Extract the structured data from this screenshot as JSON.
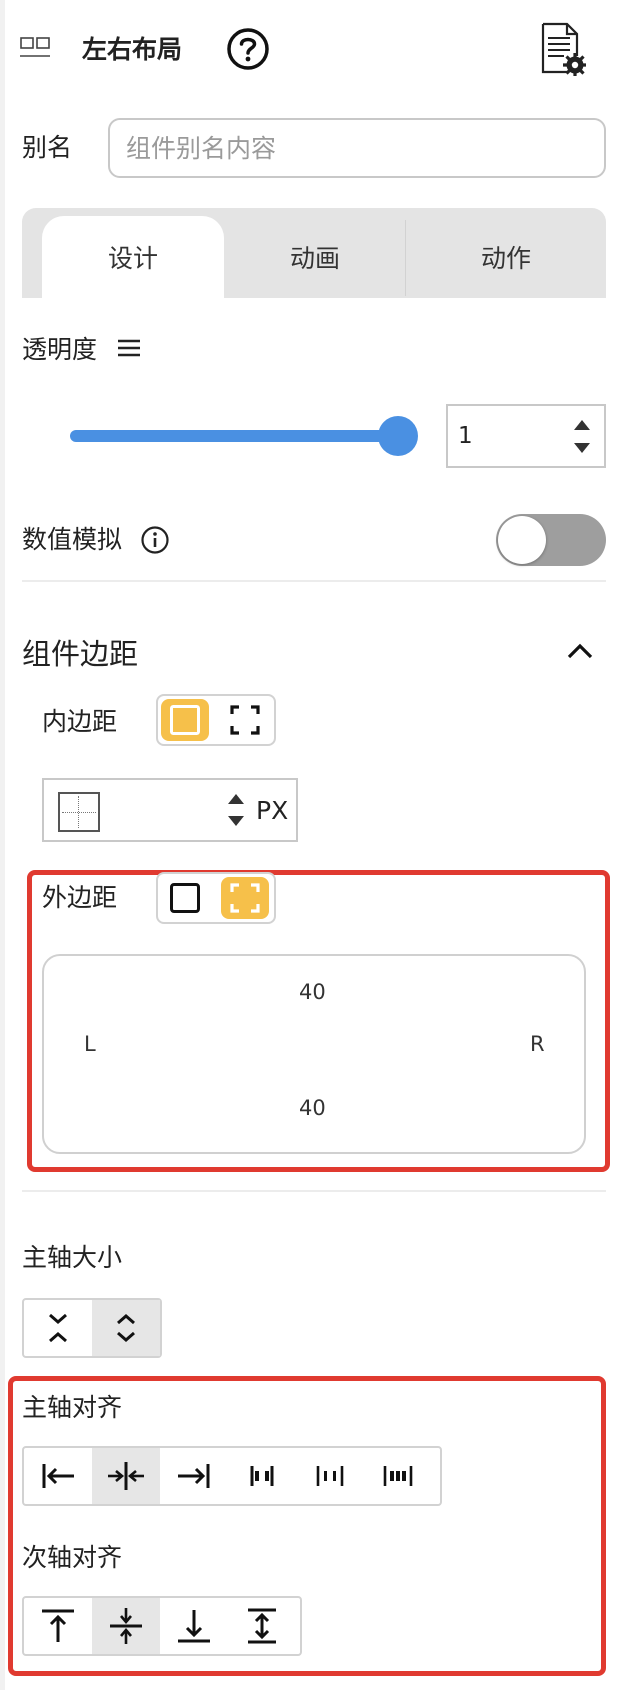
{
  "header": {
    "title": "左右布局"
  },
  "alias": {
    "label": "别名",
    "placeholder": "组件别名内容"
  },
  "tabs": [
    {
      "label": "设计"
    },
    {
      "label": "动画"
    },
    {
      "label": "动作"
    }
  ],
  "opacity": {
    "label": "透明度",
    "value": "1",
    "slider_level": 1
  },
  "value_sim": {
    "label": "数值模拟",
    "enabled": false
  },
  "component_margin": {
    "title": "组件边距",
    "padding": {
      "label": "内边距",
      "unit": "PX"
    },
    "margin": {
      "label": "外边距",
      "top": "40",
      "bottom": "40",
      "left": "L",
      "right": "R"
    }
  },
  "main_axis_size": {
    "label": "主轴大小"
  },
  "main_axis_align": {
    "label": "主轴对齐"
  },
  "cross_axis_align": {
    "label": "次轴对齐"
  },
  "colors": {
    "accent": "#4a90e2",
    "highlight": "#f6c04a",
    "annotation": "#e03a30"
  }
}
